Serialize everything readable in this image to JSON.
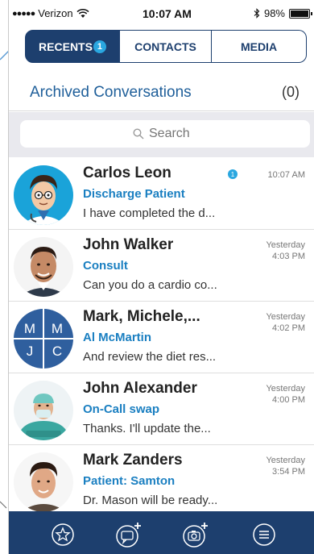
{
  "status": {
    "carrier": "Verizon",
    "time": "10:07 AM",
    "battery": "98%",
    "signal_icon": "signal-dots",
    "wifi_icon": "wifi-icon",
    "bluetooth_icon": "bluetooth-icon"
  },
  "tabs": {
    "recents": "RECENTS",
    "recents_badge": "1",
    "contacts": "CONTACTS",
    "media": "MEDIA"
  },
  "archived": {
    "label": "Archived Conversations",
    "count": "(0)"
  },
  "search": {
    "placeholder": "Search"
  },
  "conversations": [
    {
      "name": "Carlos Leon",
      "subject": "Discharge Patient",
      "preview": "I have completed the d...",
      "time_line1": "10:07 AM",
      "time_line2": "",
      "unread": "1"
    },
    {
      "name": "John Walker",
      "subject": "Consult",
      "preview": "Can you do a cardio co...",
      "time_line1": "Yesterday",
      "time_line2": "4:03 PM",
      "unread": ""
    },
    {
      "name": "Mark, Michele,...",
      "subject": "Al McMartin",
      "preview": "And review the diet res...",
      "time_line1": "Yesterday",
      "time_line2": "4:02 PM",
      "unread": "",
      "group_initials": [
        "M",
        "M",
        "J",
        "C"
      ]
    },
    {
      "name": "John Alexander",
      "subject": "On-Call swap",
      "preview": "Thanks. I'll update the...",
      "time_line1": "Yesterday",
      "time_line2": "4:00 PM",
      "unread": ""
    },
    {
      "name": "Mark Zanders",
      "subject": "Patient: Samton",
      "preview": "Dr. Mason will be ready...",
      "time_line1": "Yesterday",
      "time_line2": "3:54 PM",
      "unread": ""
    }
  ],
  "bottom_bar": {
    "icons": [
      "star-icon",
      "new-message-icon",
      "add-photo-icon",
      "menu-icon"
    ]
  },
  "colors": {
    "navy": "#1d3f6e",
    "accent_blue": "#1a7fc1",
    "badge_blue": "#2aa7e0"
  }
}
